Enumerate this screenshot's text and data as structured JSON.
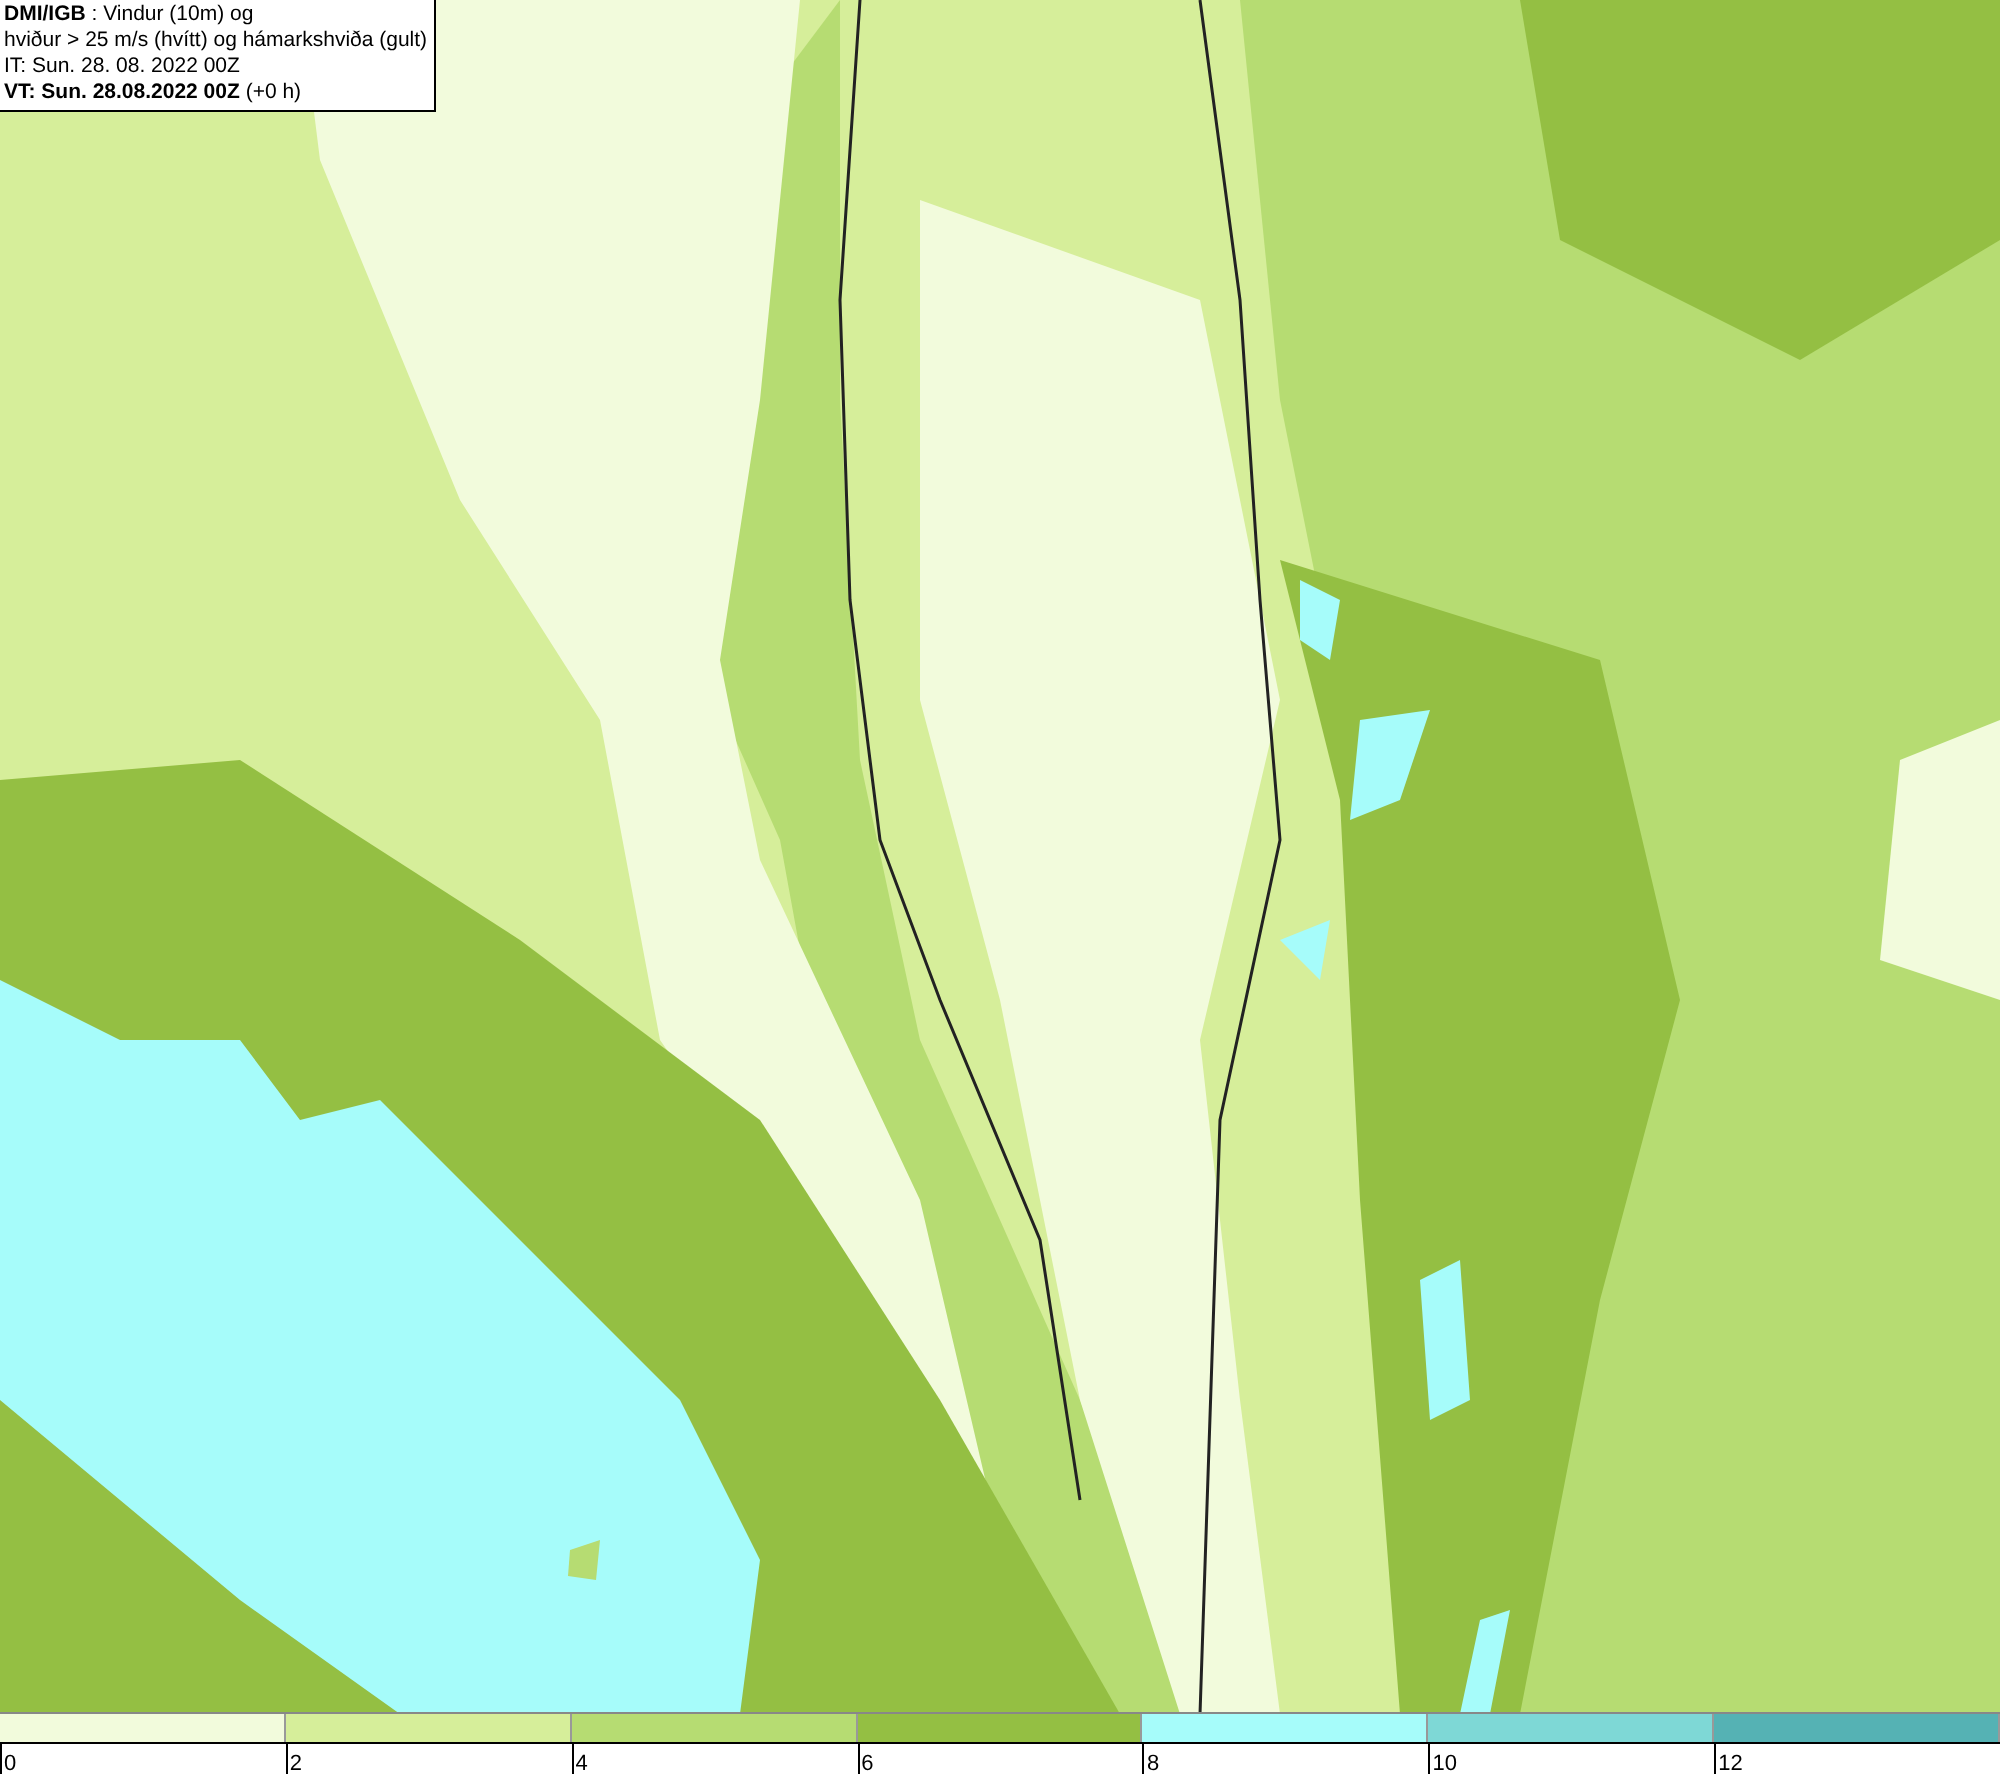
{
  "title_box": {
    "lines": [
      "**DMI/IGB** : Vindur (10m) og",
      "hviður > 25 m/s (hvítt) og hámarkshviða (gult)",
      "IT: Sun. 28. 08. 2022 00Z",
      "**VT: Sun. 28.08.2022 00Z** (+0 h)"
    ]
  },
  "legend": {
    "segments": [
      {
        "label": "0",
        "color": "#f2fbdc"
      },
      {
        "label": "2",
        "color": "#d6ee9a"
      },
      {
        "label": "4",
        "color": "#b6dc72"
      },
      {
        "label": "6",
        "color": "#94bf43"
      },
      {
        "label": "8",
        "color": "#a6fcfa"
      },
      {
        "label": "10",
        "color": "#7ed8d6"
      },
      {
        "label": "12",
        "color": "#55b2b4"
      }
    ]
  }
}
